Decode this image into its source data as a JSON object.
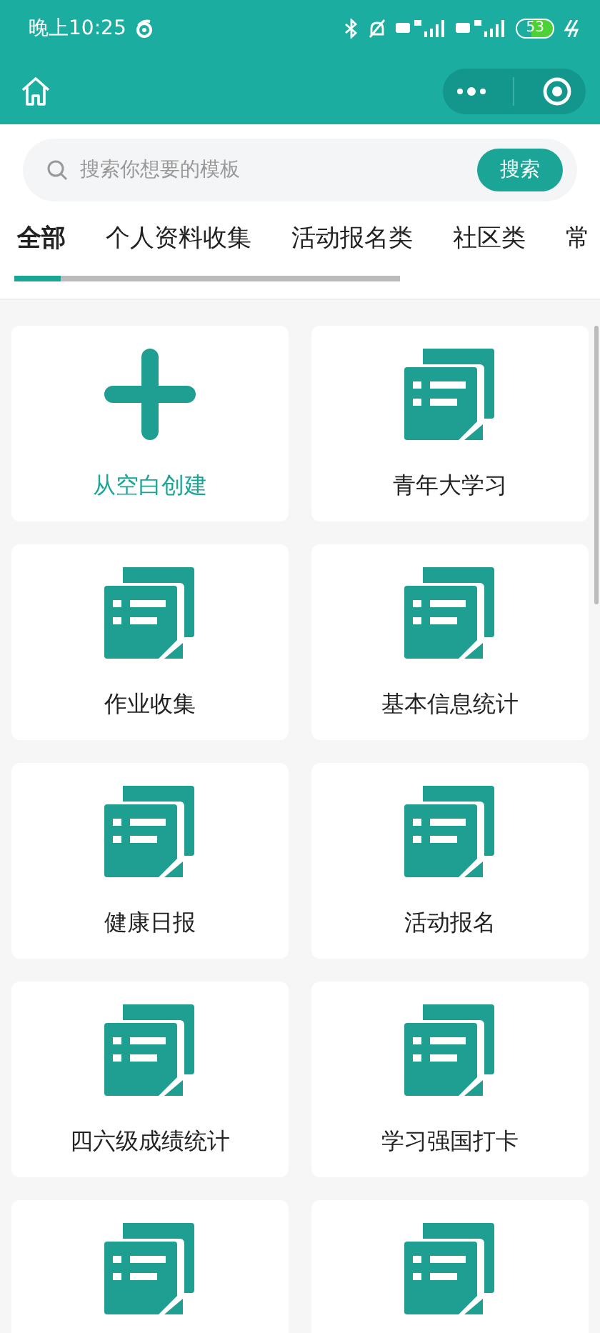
{
  "status_bar": {
    "time": "晚上10:25",
    "battery": "53"
  },
  "search": {
    "placeholder": "搜索你想要的模板",
    "button": "搜索"
  },
  "tabs": [
    {
      "label": "全部",
      "selected": true
    },
    {
      "label": "个人资料收集",
      "selected": false
    },
    {
      "label": "活动报名类",
      "selected": false
    },
    {
      "label": "社区类",
      "selected": false
    },
    {
      "label": "常",
      "selected": false
    }
  ],
  "templates": [
    {
      "kind": "create",
      "title": "从空白创建"
    },
    {
      "kind": "template",
      "title": "青年大学习"
    },
    {
      "kind": "template",
      "title": "作业收集"
    },
    {
      "kind": "template",
      "title": "基本信息统计"
    },
    {
      "kind": "template",
      "title": "健康日报"
    },
    {
      "kind": "template",
      "title": "活动报名"
    },
    {
      "kind": "template",
      "title": "四六级成绩统计"
    },
    {
      "kind": "template",
      "title": "学习强国打卡"
    },
    {
      "kind": "template"
    },
    {
      "kind": "template"
    }
  ]
}
